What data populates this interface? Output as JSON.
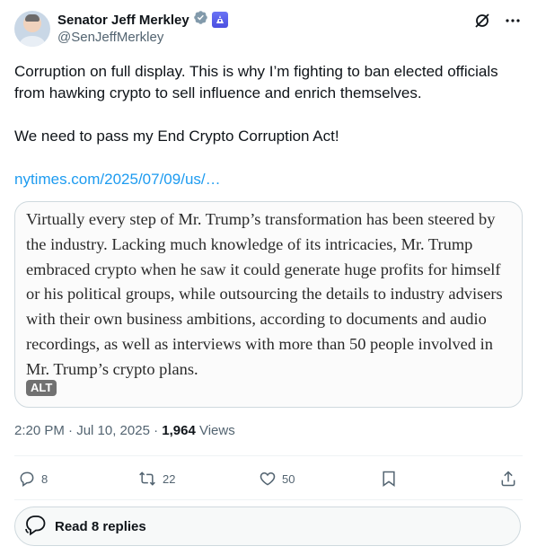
{
  "author": {
    "name": "Senator Jeff Merkley",
    "handle": "@SenJeffMerkley",
    "badges": [
      "verified-badge-icon",
      "government-badge-icon"
    ]
  },
  "header_icons": [
    "grok-icon",
    "more-icon"
  ],
  "post": {
    "text": "Corruption on full display. This is why I’m fighting to ban elected officials from hawking crypto to sell influence and enrich themselves.\n\nWe need to pass my End Crypto Corruption Act!",
    "link": "nytimes.com/2025/07/09/us/…"
  },
  "media": {
    "quote_text": "Virtually every step of Mr. Trump’s transformation has been steered by the industry. Lacking much knowledge of its intricacies, Mr. Trump embraced crypto when he saw it could generate huge profits for himself or his political groups, while outsourcing the details to industry advisers with their own business ambitions, according to documents and audio recordings, as well as interviews with more than 50 people involved in Mr. Trump’s crypto plans.",
    "alt_label": "ALT"
  },
  "meta": {
    "time_date": "2:20 PM · Jul 10, 2025 · ",
    "views_count": "1,964",
    "views_label": " Views"
  },
  "actions": {
    "replies": "8",
    "reposts": "22",
    "likes": "50"
  },
  "replies_button": {
    "label": "Read 8 replies"
  },
  "colors": {
    "link": "#1d9bf0",
    "secondary_text": "#536471",
    "verified": "#829aab",
    "border": "#cfd9de"
  }
}
